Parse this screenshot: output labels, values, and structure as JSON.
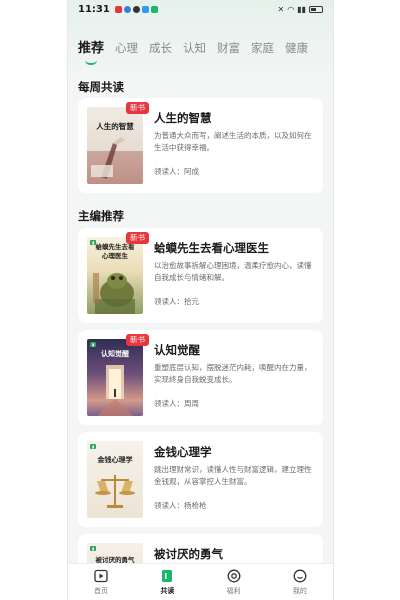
{
  "status_bar": {
    "time": "11:31",
    "notification_colors": [
      "#e8363f",
      "#3b7ddb",
      "#333333",
      "#2f9bf0",
      "#1fb36b"
    ]
  },
  "tabs": [
    {
      "label": "推荐",
      "active": true
    },
    {
      "label": "心理"
    },
    {
      "label": "成长"
    },
    {
      "label": "认知"
    },
    {
      "label": "财富"
    },
    {
      "label": "家庭"
    },
    {
      "label": "健康"
    }
  ],
  "weekly": {
    "title": "每周共读",
    "book": {
      "cover_title": "人生的智慧",
      "badge": "新书",
      "title": "人生的智慧",
      "description": "为普通大众而写，阐述生活的本质，以及如何在生活中获得幸福。",
      "reader": "领读人：阿成"
    }
  },
  "editor": {
    "title": "主编推荐",
    "books": [
      {
        "cover_title": "蛤蟆先生去看心理医生",
        "badge": "新书",
        "title": "蛤蟆先生去看心理医生",
        "description": "以治愈故事拆解心理困境，温柔疗愈内心，读懂自我成长与情绪和解。",
        "reader": "领读人：拾元"
      },
      {
        "cover_title": "认知觉醒",
        "badge": "新书",
        "title": "认知觉醒",
        "description": "重塑底层认知，摆脱迷茫内耗，唤醒内在力量，实现终身自我蜕变成长。",
        "reader": "领读人：周周"
      },
      {
        "cover_title": "金钱心理学",
        "title": "金钱心理学",
        "description": "跳出理财常识，读懂人性与财富逻辑，建立理性金钱观，从容掌控人生财富。",
        "reader": "领读人：杨枪枪"
      },
      {
        "cover_title": "被讨厌的勇气",
        "title": "被讨厌的勇气"
      }
    ]
  },
  "bottom_nav": [
    {
      "label": "首页",
      "icon": "play-square-icon"
    },
    {
      "label": "共读",
      "icon": "book-icon",
      "active": true
    },
    {
      "label": "福利",
      "icon": "gift-circle-icon"
    },
    {
      "label": "我的",
      "icon": "smile-icon"
    }
  ],
  "colors": {
    "accent": "#1fb36b",
    "badge": "#e8363f",
    "text": "#1a1a1a",
    "muted": "#6b6b6b"
  }
}
